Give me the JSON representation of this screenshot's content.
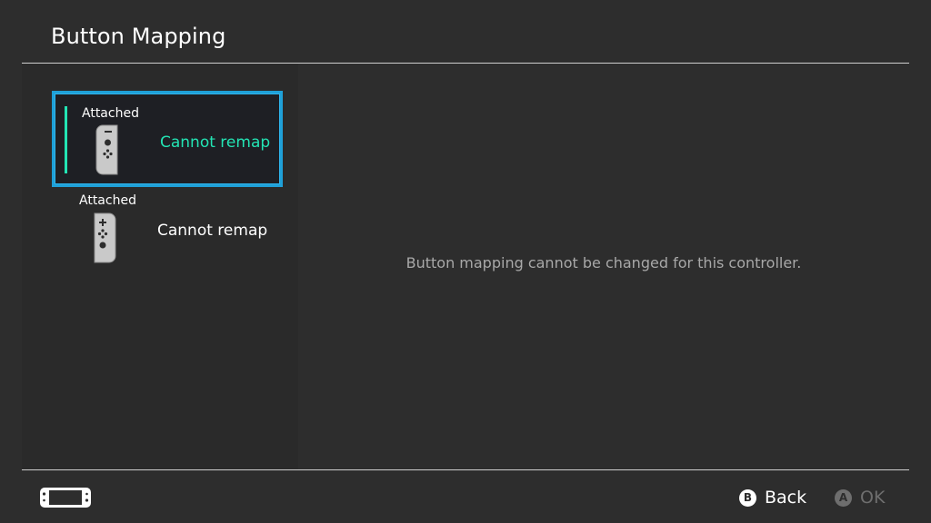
{
  "header": {
    "title": "Button Mapping"
  },
  "controllers": [
    {
      "status": "Attached",
      "label": "Cannot remap",
      "icon": "left-joycon-icon",
      "selected": true
    },
    {
      "status": "Attached",
      "label": "Cannot remap",
      "icon": "right-joycon-icon",
      "selected": false
    }
  ],
  "main": {
    "message": "Button mapping cannot be changed for this controller."
  },
  "footer": {
    "console_icon": "handheld-console-icon",
    "back": {
      "glyph": "B",
      "label": "Back"
    },
    "ok": {
      "glyph": "A",
      "label": "OK"
    }
  },
  "colors": {
    "accent": "#23e4b4",
    "selection": "#1fa0d8",
    "background": "#2d2d2d"
  }
}
